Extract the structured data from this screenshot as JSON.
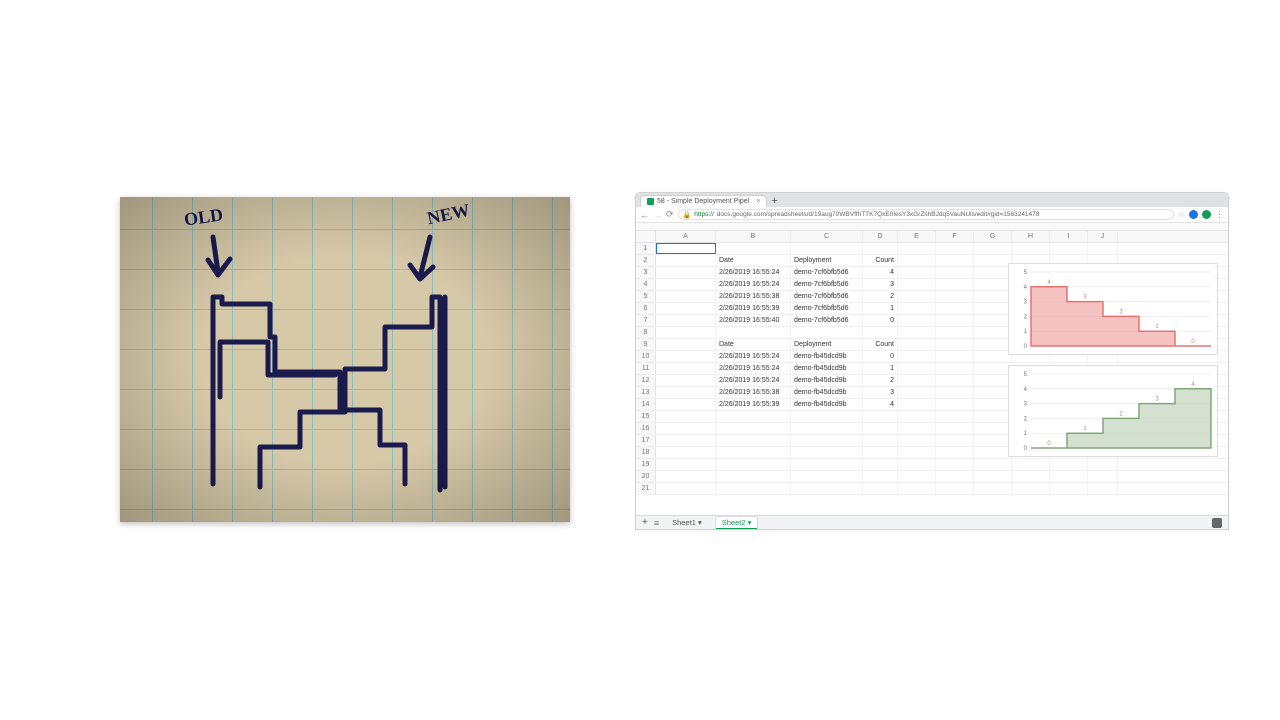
{
  "sketch": {
    "label_old": "OLD",
    "label_new": "NEW"
  },
  "browser": {
    "tab": {
      "title": "58 - Simple Deployment Pipel"
    },
    "address": {
      "secure_label": "https://",
      "url": "docs.google.com/spreadsheets/d/19aug70WBVffhTTK7QxE0IesY3xGrZshBJdq5VauNUls/edit#gid=1563241478"
    }
  },
  "sheets": {
    "columns": [
      "A",
      "B",
      "C",
      "D",
      "E",
      "F",
      "G",
      "H",
      "I",
      "J"
    ],
    "row_numbers": [
      1,
      2,
      3,
      4,
      5,
      6,
      7,
      8,
      9,
      10,
      11,
      12,
      13,
      14,
      15,
      16,
      17,
      18,
      19,
      20,
      21
    ],
    "header1": {
      "b": "Date",
      "c": "Deployment",
      "d": "Count"
    },
    "table1": [
      {
        "b": "2/26/2019 16:55:24",
        "c": "demo-7cf6bfb5d6",
        "d": "4"
      },
      {
        "b": "2/26/2019 16:55:24",
        "c": "demo-7cf6bfb5d6",
        "d": "3"
      },
      {
        "b": "2/26/2019 16:55:38",
        "c": "demo-7cf6bfb5d6",
        "d": "2"
      },
      {
        "b": "2/26/2019 16:55:39",
        "c": "demo-7cf6bfb5d6",
        "d": "1"
      },
      {
        "b": "2/26/2019 16:55:40",
        "c": "demo-7cf6bfb5d6",
        "d": "0"
      }
    ],
    "header2": {
      "b": "Date",
      "c": "Deployment",
      "d": "Count"
    },
    "table2": [
      {
        "b": "2/26/2019 16:55:24",
        "c": "demo-fb45dcd9b",
        "d": "0"
      },
      {
        "b": "2/26/2019 16:55:24",
        "c": "demo-fb45dcd9b",
        "d": "1"
      },
      {
        "b": "2/26/2019 16:55:24",
        "c": "demo-fb45dcd9b",
        "d": "2"
      },
      {
        "b": "2/26/2019 16:55:38",
        "c": "demo-fb45dcd9b",
        "d": "3"
      },
      {
        "b": "2/26/2019 16:55:39",
        "c": "demo-fb45dcd9b",
        "d": "4"
      }
    ],
    "sheet_tabs": {
      "s1": "Sheet1",
      "s2": "Sheet2",
      "active": "Sheet2"
    }
  },
  "chart_data": [
    {
      "type": "area",
      "values": [
        4,
        3,
        2,
        1,
        0
      ],
      "data_labels": [
        "4",
        "3",
        "2",
        "1",
        "0"
      ],
      "ylim": [
        0,
        5
      ],
      "yticks": [
        0,
        1,
        2,
        3,
        4,
        5
      ],
      "color": "#e57373",
      "fill": "#ef9a9a"
    },
    {
      "type": "area",
      "values": [
        0,
        1,
        2,
        3,
        4
      ],
      "data_labels": [
        "0",
        "1",
        "2",
        "3",
        "4"
      ],
      "ylim": [
        0,
        5
      ],
      "yticks": [
        0,
        1,
        2,
        3,
        4,
        5
      ],
      "color": "#81a77b",
      "fill": "#b7cdb1"
    }
  ]
}
